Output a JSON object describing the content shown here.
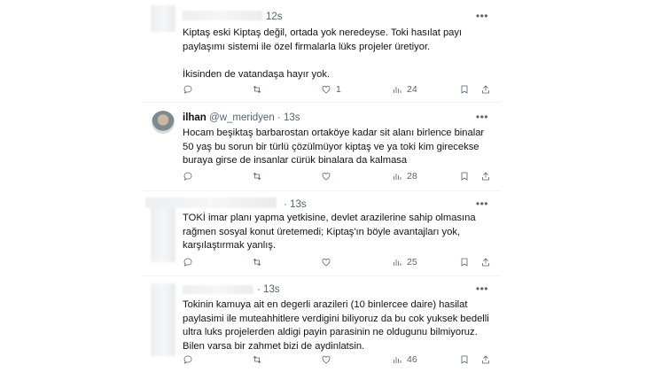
{
  "tweets": [
    {
      "name": "",
      "handle": "",
      "time": "12s",
      "more": "•••",
      "text": "Kiptaş eski Kiptaş değil, ortada yok neredeyse. Toki hasılat payı paylaşımı sistemi ile özel firmalarla lüks projeler üretiyor.\n\nİkisinden de vatandaşa hayır yok.",
      "views": "24"
    },
    {
      "name": "ilhan",
      "handle": "@w_meridyen",
      "time": "13s",
      "more": "•••",
      "text": "Hocam beşiktaş barbarostan ortaköye kadar sit alanı birlence binalar 50 yaş bu sorun bir türlü çözülmüyor kiptaş ve ya toki kim girecekse buraya girse de insanlar cürük binalara da kalmasa",
      "views": "28"
    },
    {
      "name": "",
      "handle": "",
      "time": "13s",
      "more": "•••",
      "text": "TOKİ imar planı yapma yetkisine, devlet arazilerine sahip olmasına rağmen sosyal konut üretemedi; Kiptaş'ın böyle avantajları yok, karşılaştırmak yanlış.",
      "views": "25"
    },
    {
      "name": "",
      "handle": "",
      "time": "13s",
      "more": "•••",
      "text": "Tokinin kamuya ait en degerli arazileri (10 binlercee daire) hasilat paylasimi ile muteahhitlere verdigini biliyoruz da bu cok yuksek bedelli ultra luks projelerden aldigi payin parasinin ne oldugunu bilmiyoruz. Bilen varsa bir zahmet bizi de aydinlatsin.",
      "views": "46"
    }
  ],
  "icons": {
    "reply": "reply-icon",
    "retweet": "retweet-icon",
    "like": "like-icon",
    "views": "views-icon",
    "bookmark": "bookmark-icon",
    "share": "share-icon"
  }
}
